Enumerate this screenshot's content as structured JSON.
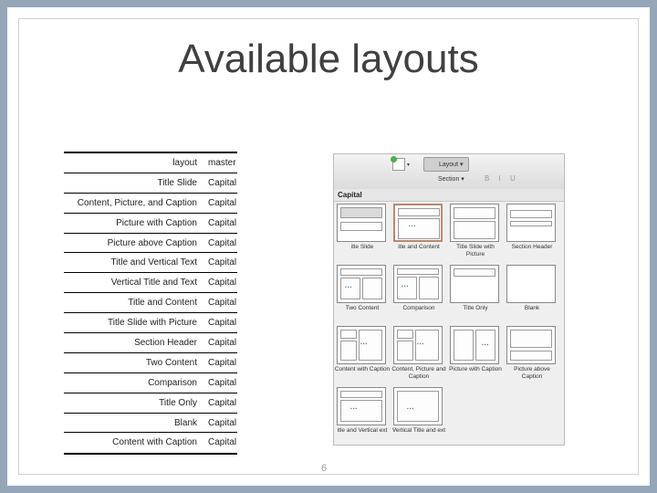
{
  "title": "Available layouts",
  "table": {
    "headers": [
      "layout",
      "master"
    ],
    "rows": [
      [
        "Title Slide",
        "Capital"
      ],
      [
        "Content, Picture, and Caption",
        "Capital"
      ],
      [
        "Picture with Caption",
        "Capital"
      ],
      [
        "Picture above Caption",
        "Capital"
      ],
      [
        "Title and Vertical Text",
        "Capital"
      ],
      [
        "Vertical Title and Text",
        "Capital"
      ],
      [
        "Title and Content",
        "Capital"
      ],
      [
        "Title Slide with Picture",
        "Capital"
      ],
      [
        "Section Header",
        "Capital"
      ],
      [
        "Two Content",
        "Capital"
      ],
      [
        "Comparison",
        "Capital"
      ],
      [
        "Title Only",
        "Capital"
      ],
      [
        "Blank",
        "Capital"
      ],
      [
        "Content with Caption",
        "Capital"
      ]
    ]
  },
  "screenshot": {
    "toolbar": {
      "layout_label": "Layout ▾",
      "section_label": "Section ▾"
    },
    "panel_title": "Capital",
    "layouts": [
      {
        "caption": "itle Slide"
      },
      {
        "caption": "itle and Content"
      },
      {
        "caption": "Title Slide with Picture"
      },
      {
        "caption": "Section Header"
      },
      {
        "caption": "Two Content"
      },
      {
        "caption": "Comparison"
      },
      {
        "caption": "Title Only"
      },
      {
        "caption": "Blank"
      },
      {
        "caption": "Content with Caption"
      },
      {
        "caption": "Content, Picture and Caption"
      },
      {
        "caption": "Picture with Caption"
      },
      {
        "caption": "Picture above Caption"
      },
      {
        "caption": "itle and Vertical ext"
      },
      {
        "caption": "Vertical Title and ext"
      }
    ]
  },
  "page_number": "6",
  "colors": {
    "frame": "#94a6b8",
    "selected_border": "#b9886a"
  }
}
